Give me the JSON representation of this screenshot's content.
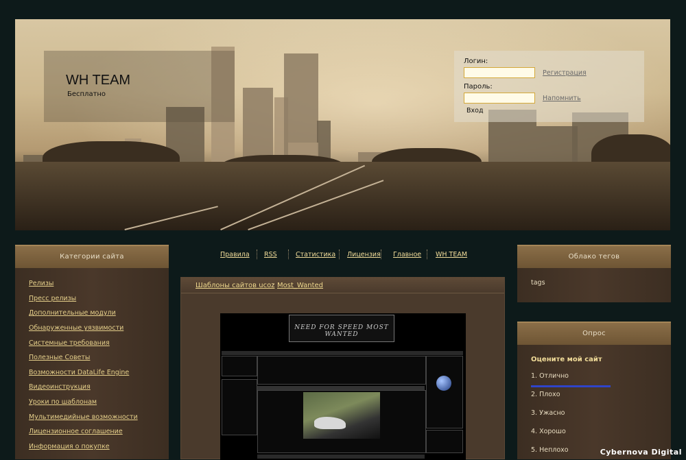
{
  "header": {
    "site_title": "WH TEAM",
    "site_subtitle": "Бесплатно"
  },
  "login": {
    "login_label": "Логин:",
    "password_label": "Пароль:",
    "register_link": "Регистрация",
    "remind_link": "Напомнить",
    "submit_label": "Вход",
    "login_value": "",
    "password_value": ""
  },
  "categories": {
    "title": "Категории сайта",
    "items": [
      "Релизы",
      "Пресс релизы",
      "Дополнительные модули",
      "Обнаруженные уязвимости",
      "Системные требования",
      "Полезные Советы",
      "Возможности DataLife Engine",
      "Видеоинструкция",
      "Уроки по шаблонам",
      "Мультимедийные возможности",
      "Лицензионное соглашение",
      "Информация о покупке"
    ]
  },
  "nav": {
    "items": [
      "Правила",
      "RSS",
      "Статистика",
      "Лицензия",
      "Главное",
      "WH TEAM"
    ]
  },
  "content": {
    "breadcrumb": [
      "Шаблоны сайтов ucoz",
      "Most_Wanted"
    ],
    "breadcrumb_sep": "›",
    "logo_text": "NEED FOR SPEED MOST WANTED"
  },
  "tags_cloud": {
    "title": "Облако тегов",
    "text": "tags"
  },
  "poll": {
    "title": "Опрос",
    "question": "Оцените мой сайт",
    "options": [
      "1. Отлично",
      "2. Плохо",
      "3. Ужасно",
      "4. Хорошо",
      "5. Неплохо"
    ],
    "bar_fraction": 1.0,
    "bar_color": "#2f44c9"
  },
  "watermark": "Cybernova Digital",
  "colors": {
    "background": "#0d1a1a",
    "link": "#e6d08b",
    "panel_head": "#7a6140"
  }
}
